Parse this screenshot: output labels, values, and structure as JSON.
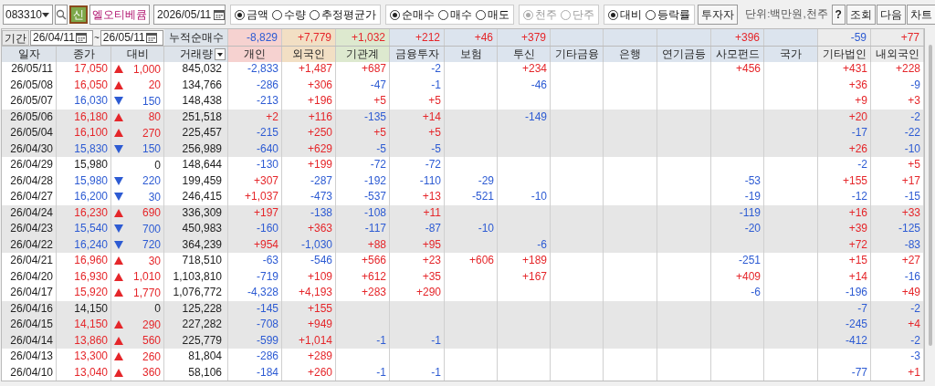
{
  "toolbar": {
    "stock_code": "083310",
    "badge": "신",
    "stock_name": "엘오티베큠",
    "date": "2026/05/11",
    "option_groups": [
      {
        "disabled": false,
        "options": [
          {
            "label": "금액",
            "selected": true
          },
          {
            "label": "수량",
            "selected": false
          },
          {
            "label": "추정평균가",
            "selected": false
          }
        ]
      },
      {
        "disabled": false,
        "options": [
          {
            "label": "순매수",
            "selected": true
          },
          {
            "label": "매수",
            "selected": false
          },
          {
            "label": "매도",
            "selected": false
          }
        ]
      },
      {
        "disabled": true,
        "options": [
          {
            "label": "천주",
            "selected": true
          },
          {
            "label": "단주",
            "selected": false
          }
        ]
      },
      {
        "disabled": false,
        "options": [
          {
            "label": "대비",
            "selected": true
          },
          {
            "label": "등락률",
            "selected": false
          }
        ]
      }
    ],
    "investor_button": "투자자",
    "unit": "단위:백만원,천주",
    "buttons": [
      "?",
      "조회",
      "다음",
      "차트"
    ]
  },
  "period": {
    "label": "기간",
    "from": "26/04/11",
    "separator": "~",
    "to": "26/05/11",
    "total_label": "누적순매수",
    "totals": {
      "individual": "-8,829",
      "foreign": "+7,779",
      "institutions": "+1,032",
      "financial_investment": "+212",
      "insurance": "+46",
      "investment_trust": "+379",
      "private_fund": "+396",
      "other_corporation": "-59",
      "other_foreigner": "+77"
    }
  },
  "table": {
    "columns": [
      {
        "label": "일자",
        "color": "#dde3ea"
      },
      {
        "label": "종가",
        "color": "#dde3ea"
      },
      {
        "label": "대비",
        "color": "#dde3ea"
      },
      {
        "label": "거래량",
        "color": "#dde3ea"
      },
      {
        "label": "개인",
        "color": "#f6d2d0"
      },
      {
        "label": "외국인",
        "color": "#f2dfc4"
      },
      {
        "label": "기관계",
        "color": "#dde9cf"
      },
      {
        "label": "금융투자",
        "color": "#dce4ee"
      },
      {
        "label": "보험",
        "color": "#dce4ee"
      },
      {
        "label": "투신",
        "color": "#dce4ee"
      },
      {
        "label": "기타금융",
        "color": "#dce4ee"
      },
      {
        "label": "은행",
        "color": "#dce4ee"
      },
      {
        "label": "연기금등",
        "color": "#dce4ee"
      },
      {
        "label": "사모펀드",
        "color": "#dce4ee"
      },
      {
        "label": "국가",
        "color": "#dce4ee"
      },
      {
        "label": "기타법인",
        "color": "#ececec"
      },
      {
        "label": "내외국인",
        "color": "#ececec"
      }
    ],
    "rows": [
      {
        "shaded": false,
        "date": "26/05/11",
        "close": "17,050",
        "kind": "up",
        "diff": "1,000",
        "volume": "845,032",
        "investors": {
          "individual": "-2,833",
          "foreign": "+1,487",
          "institutions": "+687",
          "financial_investment": "-2",
          "investment_trust": "+234",
          "private_fund": "+456",
          "other_corporation": "+431",
          "other_foreigner": "+228"
        }
      },
      {
        "shaded": false,
        "date": "26/05/08",
        "close": "16,050",
        "kind": "up",
        "diff": "20",
        "volume": "134,766",
        "investors": {
          "individual": "-286",
          "foreign": "+306",
          "institutions": "-47",
          "financial_investment": "-1",
          "investment_trust": "-46",
          "other_corporation": "+36",
          "other_foreigner": "-9"
        }
      },
      {
        "shaded": false,
        "date": "26/05/07",
        "close": "16,030",
        "kind": "down",
        "diff": "150",
        "volume": "148,438",
        "investors": {
          "individual": "-213",
          "foreign": "+196",
          "institutions": "+5",
          "financial_investment": "+5",
          "other_corporation": "+9",
          "other_foreigner": "+3"
        }
      },
      {
        "shaded": true,
        "date": "26/05/06",
        "close": "16,180",
        "kind": "up",
        "diff": "80",
        "volume": "251,518",
        "investors": {
          "individual": "+2",
          "foreign": "+116",
          "institutions": "-135",
          "financial_investment": "+14",
          "investment_trust": "-149",
          "other_corporation": "+20",
          "other_foreigner": "-2"
        }
      },
      {
        "shaded": true,
        "date": "26/05/04",
        "close": "16,100",
        "kind": "up",
        "diff": "270",
        "volume": "225,457",
        "investors": {
          "individual": "-215",
          "foreign": "+250",
          "institutions": "+5",
          "financial_investment": "+5",
          "other_corporation": "-17",
          "other_foreigner": "-22"
        }
      },
      {
        "shaded": true,
        "date": "26/04/30",
        "close": "15,830",
        "kind": "down",
        "diff": "150",
        "volume": "256,989",
        "investors": {
          "individual": "-640",
          "foreign": "+629",
          "institutions": "-5",
          "financial_investment": "-5",
          "other_corporation": "+26",
          "other_foreigner": "-10"
        }
      },
      {
        "shaded": false,
        "date": "26/04/29",
        "close": "15,980",
        "kind": "flat",
        "diff": "0",
        "volume": "148,644",
        "investors": {
          "individual": "-130",
          "foreign": "+199",
          "institutions": "-72",
          "financial_investment": "-72",
          "other_corporation": "-2",
          "other_foreigner": "+5"
        }
      },
      {
        "shaded": false,
        "date": "26/04/28",
        "close": "15,980",
        "kind": "down",
        "diff": "220",
        "volume": "199,459",
        "investors": {
          "individual": "+307",
          "foreign": "-287",
          "institutions": "-192",
          "financial_investment": "-110",
          "insurance": "-29",
          "private_fund": "-53",
          "other_corporation": "+155",
          "other_foreigner": "+17"
        }
      },
      {
        "shaded": false,
        "date": "26/04/27",
        "close": "16,200",
        "kind": "down",
        "diff": "30",
        "volume": "246,415",
        "investors": {
          "individual": "+1,037",
          "foreign": "-473",
          "institutions": "-537",
          "financial_investment": "+13",
          "insurance": "-521",
          "investment_trust": "-10",
          "private_fund": "-19",
          "other_corporation": "-12",
          "other_foreigner": "-15"
        }
      },
      {
        "shaded": true,
        "date": "26/04/24",
        "close": "16,230",
        "kind": "up",
        "diff": "690",
        "volume": "336,309",
        "investors": {
          "individual": "+197",
          "foreign": "-138",
          "institutions": "-108",
          "financial_investment": "+11",
          "private_fund": "-119",
          "other_corporation": "+16",
          "other_foreigner": "+33"
        }
      },
      {
        "shaded": true,
        "date": "26/04/23",
        "close": "15,540",
        "kind": "down",
        "diff": "700",
        "volume": "450,983",
        "investors": {
          "individual": "-160",
          "foreign": "+363",
          "institutions": "-117",
          "financial_investment": "-87",
          "insurance": "-10",
          "private_fund": "-20",
          "other_corporation": "+39",
          "other_foreigner": "-125"
        }
      },
      {
        "shaded": true,
        "date": "26/04/22",
        "close": "16,240",
        "kind": "down",
        "diff": "720",
        "volume": "364,239",
        "investors": {
          "individual": "+954",
          "foreign": "-1,030",
          "institutions": "+88",
          "financial_investment": "+95",
          "investment_trust": "-6",
          "other_corporation": "+72",
          "other_foreigner": "-83"
        }
      },
      {
        "shaded": false,
        "date": "26/04/21",
        "close": "16,960",
        "kind": "up",
        "diff": "30",
        "volume": "718,510",
        "investors": {
          "individual": "-63",
          "foreign": "-546",
          "institutions": "+566",
          "financial_investment": "+23",
          "insurance": "+606",
          "investment_trust": "+189",
          "private_fund": "-251",
          "other_corporation": "+15",
          "other_foreigner": "+27"
        }
      },
      {
        "shaded": false,
        "date": "26/04/20",
        "close": "16,930",
        "kind": "up",
        "diff": "1,010",
        "volume": "1,103,810",
        "investors": {
          "individual": "-719",
          "foreign": "+109",
          "institutions": "+612",
          "financial_investment": "+35",
          "investment_trust": "+167",
          "private_fund": "+409",
          "other_corporation": "+14",
          "other_foreigner": "-16"
        }
      },
      {
        "shaded": false,
        "date": "26/04/17",
        "close": "15,920",
        "kind": "up",
        "diff": "1,770",
        "volume": "1,076,772",
        "investors": {
          "individual": "-4,328",
          "foreign": "+4,193",
          "institutions": "+283",
          "financial_investment": "+290",
          "private_fund": "-6",
          "other_corporation": "-196",
          "other_foreigner": "+49"
        }
      },
      {
        "shaded": true,
        "date": "26/04/16",
        "close": "14,150",
        "kind": "flat",
        "diff": "0",
        "volume": "125,228",
        "investors": {
          "individual": "-145",
          "foreign": "+155",
          "other_corporation": "-7",
          "other_foreigner": "-2"
        }
      },
      {
        "shaded": true,
        "date": "26/04/15",
        "close": "14,150",
        "kind": "up",
        "diff": "290",
        "volume": "227,282",
        "investors": {
          "individual": "-708",
          "foreign": "+949",
          "other_corporation": "-245",
          "other_foreigner": "+4"
        }
      },
      {
        "shaded": true,
        "date": "26/04/14",
        "close": "13,860",
        "kind": "up",
        "diff": "560",
        "volume": "225,779",
        "investors": {
          "individual": "-599",
          "foreign": "+1,014",
          "institutions": "-1",
          "financial_investment": "-1",
          "other_corporation": "-412",
          "other_foreigner": "-2"
        }
      },
      {
        "shaded": false,
        "date": "26/04/13",
        "close": "13,300",
        "kind": "up",
        "diff": "260",
        "volume": "81,804",
        "investors": {
          "individual": "-286",
          "foreign": "+289",
          "other_foreigner": "-3"
        }
      },
      {
        "shaded": false,
        "date": "26/04/10",
        "close": "13,040",
        "kind": "up",
        "diff": "360",
        "volume": "58,106",
        "investors": {
          "individual": "-184",
          "foreign": "+260",
          "institutions": "-1",
          "financial_investment": "-1",
          "other_corporation": "-77",
          "other_foreigner": "+1"
        }
      }
    ]
  }
}
